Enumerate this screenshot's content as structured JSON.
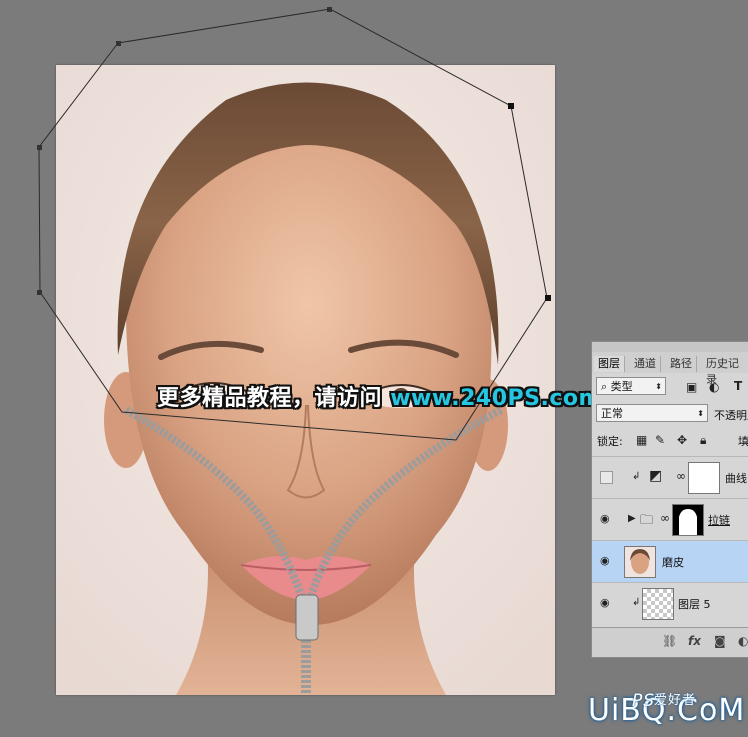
{
  "canvas": {
    "overlay_text": "更多精品教程，请访问",
    "overlay_url": "www.240PS.com"
  },
  "layers_panel": {
    "tabs": [
      "图层",
      "通道",
      "路径",
      "历史记录"
    ],
    "filter_kind": "类型",
    "blend_mode": "正常",
    "opacity_label": "不透明度",
    "lock_label": "锁定:",
    "fill_label": "填充",
    "layers": [
      {
        "name": "曲线",
        "type": "adjustment",
        "visible": false,
        "clipped": true,
        "selected": false
      },
      {
        "name": "拉链",
        "type": "group",
        "visible": true,
        "clipped": false,
        "selected": false
      },
      {
        "name": "磨皮",
        "type": "pixel",
        "visible": true,
        "clipped": false,
        "selected": true
      },
      {
        "name": "图层 5",
        "type": "pixel",
        "visible": true,
        "clipped": true,
        "selected": false
      }
    ],
    "bottom_icons": [
      "link-icon",
      "fx-icon",
      "mask-icon",
      "adjustment-icon"
    ]
  },
  "site_watermark": {
    "text": "UiBQ.CoM",
    "ps_mark": "PS",
    "cn_text": "爱好者"
  },
  "colors": {
    "workspace": "#7b7b7b",
    "selected_layer": "#b7d4f5",
    "url_accent": "#26c6e0"
  }
}
